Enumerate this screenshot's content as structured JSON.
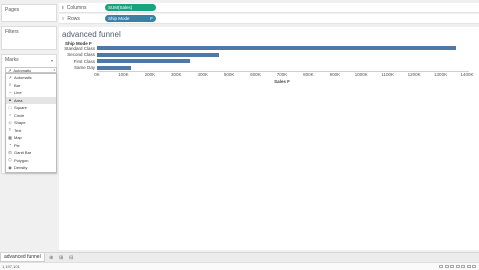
{
  "left_panels": {
    "pages_title": "Pages",
    "filters_title": "Filters",
    "marks_title": "Marks",
    "marks_selected": "Automatic",
    "mark_types": [
      {
        "label": "Automatic",
        "icon": "auto-icon",
        "glyph": "↗"
      },
      {
        "label": "Bar",
        "icon": "bar-icon",
        "glyph": "≡"
      },
      {
        "label": "Line",
        "icon": "line-icon",
        "glyph": "∼"
      },
      {
        "label": "Area",
        "icon": "area-icon",
        "glyph": "▲"
      },
      {
        "label": "Square",
        "icon": "square-icon",
        "glyph": "□"
      },
      {
        "label": "Circle",
        "icon": "circle-icon",
        "glyph": "○"
      },
      {
        "label": "Shape",
        "icon": "shape-icon",
        "glyph": "◇"
      },
      {
        "label": "Text",
        "icon": "text-icon",
        "glyph": "T"
      },
      {
        "label": "Map",
        "icon": "map-icon",
        "glyph": "▦"
      },
      {
        "label": "Pie",
        "icon": "pie-icon",
        "glyph": "◔"
      },
      {
        "label": "Gantt Bar",
        "icon": "gantt-bar-icon",
        "glyph": "⊟"
      },
      {
        "label": "Polygon",
        "icon": "polygon-icon",
        "glyph": "⬠"
      },
      {
        "label": "Density",
        "icon": "density-icon",
        "glyph": "◉"
      }
    ],
    "active_mark_index": 3
  },
  "shelves": {
    "columns_label": "Columns",
    "columns_pill": "SUM(Sales)",
    "rows_label": "Rows",
    "rows_pill": "Ship Mode",
    "rows_pill_icon": "F"
  },
  "colors": {
    "bar": "#4e79a7",
    "columns_pill": "#16a37e",
    "rows_pill": "#3a7fa6"
  },
  "viz": {
    "title": "advanced funnel"
  },
  "chart_data": {
    "type": "bar",
    "orientation": "horizontal",
    "title": "advanced funnel",
    "row_header": "Ship Mode",
    "row_header_icon": "F",
    "categories": [
      "Standard Class",
      "Second Class",
      "First Class",
      "Same Day"
    ],
    "values": [
      1358000,
      460000,
      352000,
      128000
    ],
    "xlabel": "Sales",
    "xlabel_icon": "F",
    "xlim": [
      0,
      1400000
    ],
    "x_ticks": [
      "0K",
      "100K",
      "200K",
      "300K",
      "400K",
      "500K",
      "600K",
      "700K",
      "800K",
      "900K",
      "1000K",
      "1100K",
      "1200K",
      "1300K",
      "1400K"
    ],
    "grid": false
  },
  "bottom": {
    "sheet_tab": "advanced funnel",
    "status_text": "1,197,101"
  }
}
